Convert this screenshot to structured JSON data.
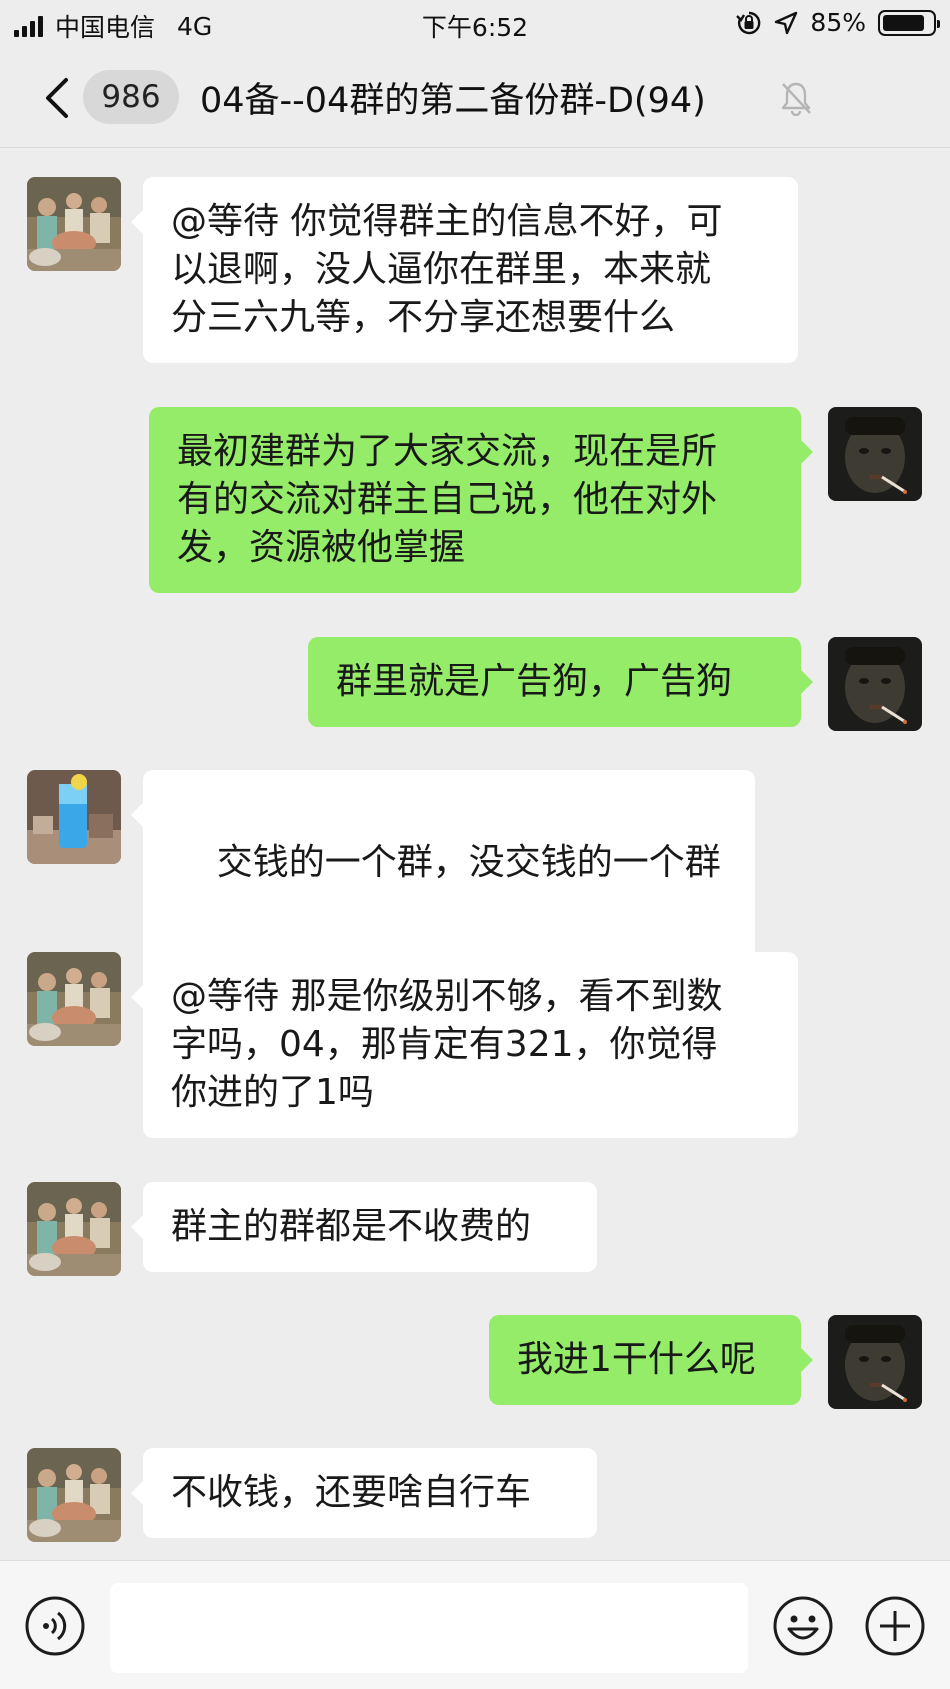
{
  "status_bar": {
    "carrier": "中国电信",
    "network": "4G",
    "time": "下午6:52",
    "battery": "85%",
    "battery_level": 0.85
  },
  "header": {
    "unread_count": "986",
    "title": "04备--04群的第二备份群-D(94)"
  },
  "messages": [
    {
      "side": "in",
      "avatar": "group-photo-avatar",
      "text": "@等待 你觉得群主的信息不好，可\n以退啊，没人逼你在群里，本来就\n分三六九等，不分享还想要什么"
    },
    {
      "side": "out",
      "avatar": "self-dark-avatar",
      "text": "最初建群为了大家交流，现在是所\n有的交流对群主自己说，他在对外\n发，资源被他掌握"
    },
    {
      "side": "out",
      "avatar": "self-dark-avatar",
      "text": "群里就是广告狗，广告狗"
    },
    {
      "side": "in",
      "avatar": "blue-drink-avatar",
      "text": "交钱的一个群，没交钱的一个群",
      "emoji": "laughing-tears-emoji"
    },
    {
      "side": "in",
      "avatar": "group-photo-avatar",
      "text": "@等待 那是你级别不够，看不到数\n字吗，04，那肯定有321，你觉得\n你进的了1吗"
    },
    {
      "side": "in",
      "avatar": "group-photo-avatar",
      "text": "群主的群都是不收费的"
    },
    {
      "side": "out",
      "avatar": "self-dark-avatar",
      "text": "我进1干什么呢"
    },
    {
      "side": "in",
      "avatar": "group-photo-avatar",
      "text": "不收钱，还要啥自行车"
    }
  ],
  "input": {
    "value": "",
    "placeholder": ""
  }
}
